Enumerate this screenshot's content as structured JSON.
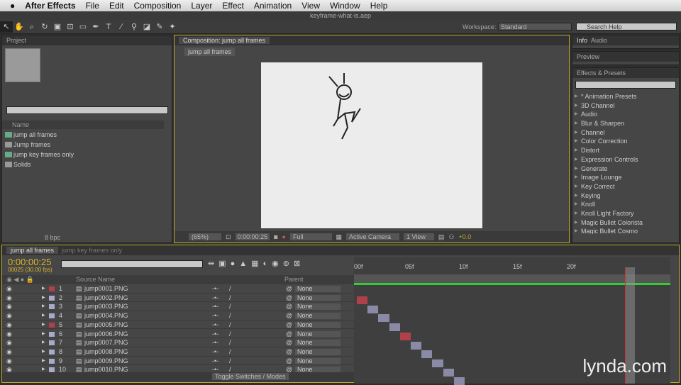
{
  "menubar": {
    "apple": "",
    "app": "After Effects",
    "items": [
      "File",
      "Edit",
      "Composition",
      "Layer",
      "Effect",
      "Animation",
      "View",
      "Window",
      "Help"
    ]
  },
  "window_title": "keyframe-what-is.aep",
  "toolbar": {
    "workspace_label": "Workspace:",
    "workspace_value": "Standard",
    "search_placeholder": "Search Help"
  },
  "project": {
    "tab": "Project",
    "col_name": "Name",
    "items": [
      {
        "label": "jump all frames",
        "icon": "composition-icon"
      },
      {
        "label": "Jump frames",
        "icon": "folder-icon"
      },
      {
        "label": "jump key frames only",
        "icon": "composition-icon"
      },
      {
        "label": "Solids",
        "icon": "folder-icon"
      }
    ],
    "bpc": "8 bpc"
  },
  "composition": {
    "tab": "Composition: jump all frames",
    "sub_tab": "jump all frames",
    "zoom": "(65%)",
    "timecode": "0:00:00:25",
    "resolution": "Full",
    "camera": "Active Camera",
    "view": "1 View",
    "exposure": "+0.0"
  },
  "right": {
    "tabs": [
      "Info",
      "Audio"
    ],
    "preview_tab": "Preview",
    "effects_tab": "Effects & Presets",
    "effects": [
      "* Animation Presets",
      "3D Channel",
      "Audio",
      "Blur & Sharpen",
      "Channel",
      "Color Correction",
      "Distort",
      "Expression Controls",
      "Generate",
      "Image Lounge",
      "Key Correct",
      "Keying",
      "Knoll",
      "Knoll Light Factory",
      "Magic Bullet Colorista",
      "Magic Bullet Cosmo"
    ]
  },
  "timeline": {
    "tabs": [
      "jump all frames",
      "jump key frames only"
    ],
    "timecode": "0:00:00:25",
    "frame_info": "00025 (30.00 fps)",
    "col_source": "Source Name",
    "col_parent": "Parent",
    "toggle": "Toggle Switches / Modes",
    "ruler": [
      "00f",
      "05f",
      "10f",
      "15f",
      "20f"
    ],
    "current_frame": 25,
    "layers": [
      {
        "num": "1",
        "name": "jump0001.PNG",
        "parent": "None",
        "color": "#b0414a",
        "frame": 0
      },
      {
        "num": "2",
        "name": "jump0002.PNG",
        "parent": "None",
        "color": "#a9a9c8",
        "frame": 1
      },
      {
        "num": "3",
        "name": "jump0003.PNG",
        "parent": "None",
        "color": "#a9a9c8",
        "frame": 2
      },
      {
        "num": "4",
        "name": "jump0004.PNG",
        "parent": "None",
        "color": "#a9a9c8",
        "frame": 3
      },
      {
        "num": "5",
        "name": "jump0005.PNG",
        "parent": "None",
        "color": "#b0414a",
        "frame": 4
      },
      {
        "num": "6",
        "name": "jump0006.PNG",
        "parent": "None",
        "color": "#a9a9c8",
        "frame": 5
      },
      {
        "num": "7",
        "name": "jump0007.PNG",
        "parent": "None",
        "color": "#a9a9c8",
        "frame": 6
      },
      {
        "num": "8",
        "name": "jump0008.PNG",
        "parent": "None",
        "color": "#a9a9c8",
        "frame": 7
      },
      {
        "num": "9",
        "name": "jump0009.PNG",
        "parent": "None",
        "color": "#a9a9c8",
        "frame": 8
      },
      {
        "num": "10",
        "name": "jump0010.PNG",
        "parent": "None",
        "color": "#a9a9c8",
        "frame": 9
      }
    ]
  },
  "watermark": "lynda.com"
}
